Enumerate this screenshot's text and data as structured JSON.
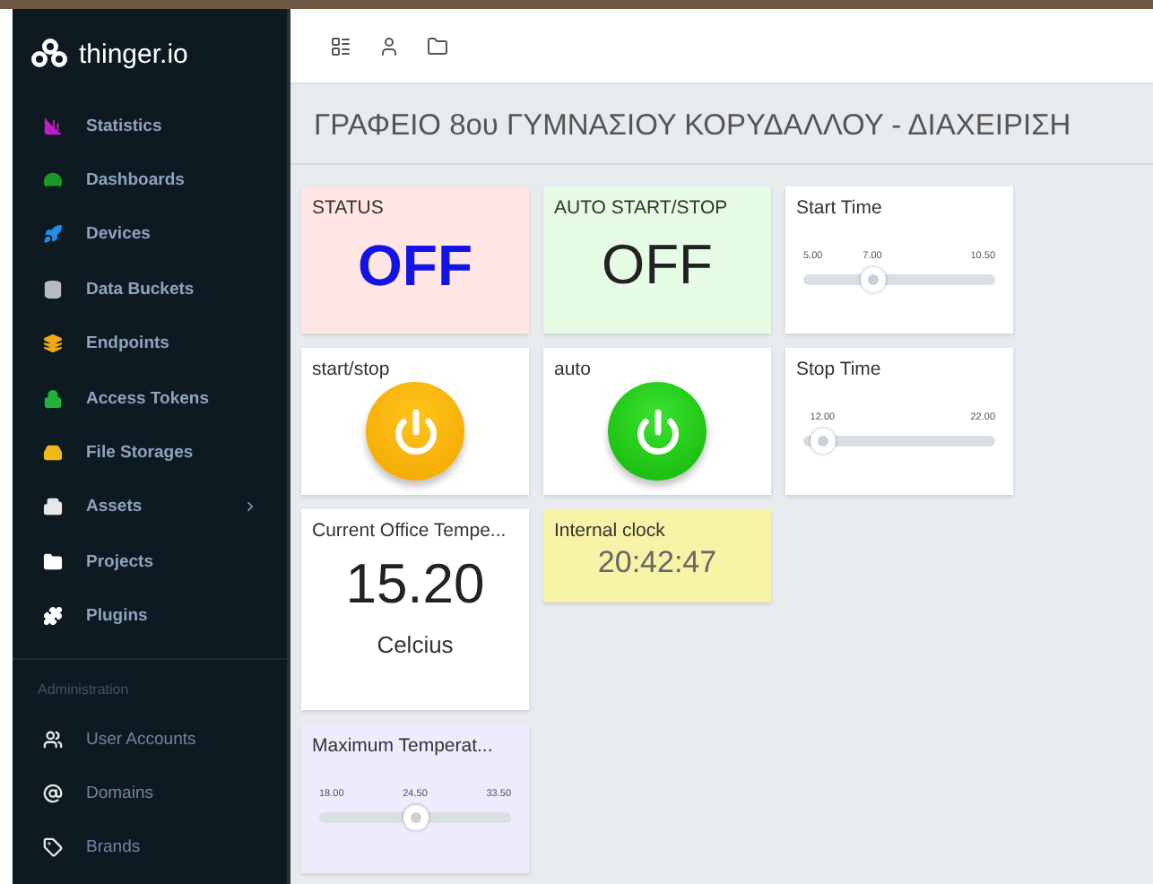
{
  "sidebar": {
    "brand": "thinger.io",
    "items": [
      {
        "label": "Statistics",
        "color": "#c01ec8",
        "arrow": false
      },
      {
        "label": "Dashboards",
        "color": "#1a9a2a",
        "arrow": false
      },
      {
        "label": "Devices",
        "color": "#1e8fe8",
        "arrow": false
      },
      {
        "label": "Data Buckets",
        "color": "#b8bcc0",
        "arrow": false
      },
      {
        "label": "Endpoints",
        "color": "#f0a818",
        "arrow": false
      },
      {
        "label": "Access Tokens",
        "color": "#22b43a",
        "arrow": false
      },
      {
        "label": "File Storages",
        "color": "#f0b818",
        "arrow": false
      },
      {
        "label": "Assets",
        "color": "#e8e8e8",
        "arrow": true
      },
      {
        "label": "Projects",
        "color": "#ffffff",
        "arrow": false
      },
      {
        "label": "Plugins",
        "color": "#ffffff",
        "arrow": false
      }
    ],
    "section": "Administration",
    "admin_items": [
      {
        "label": "User Accounts"
      },
      {
        "label": "Domains"
      },
      {
        "label": "Brands"
      }
    ]
  },
  "title": "ΓΡΑΦΕΙΟ 8ου ΓΥΜΝΑΣΙΟΥ ΚΟΡΥΔΑΛΛΟΥ - ΔΙΑΧΕΙΡΙΣΗ",
  "rows": [
    [
      {
        "kind": "value",
        "title": "STATUS",
        "value": "OFF",
        "emphasis": true,
        "color": "#ffe6e4"
      },
      {
        "kind": "value",
        "title": "AUTO START/STOP",
        "value": "OFF",
        "emphasis": false,
        "color": "#e6fbe4"
      },
      {
        "kind": "slider",
        "title": "Start Time",
        "labels": [
          {
            "kind": "min",
            "text": "5.00"
          },
          {
            "kind": "value",
            "text": "7.00"
          },
          {
            "kind": "max",
            "text": "10.50"
          }
        ],
        "level": 0.36,
        "color": "#ffffff"
      }
    ],
    [
      {
        "kind": "power",
        "title": "start/stop",
        "on": false,
        "color": "#ffffff"
      },
      {
        "kind": "power",
        "title": "auto",
        "on": true,
        "color": "#ffffff"
      },
      {
        "kind": "slider",
        "title": "Stop Time",
        "labels": [
          {
            "kind": "value",
            "text": "12.00"
          },
          {
            "kind": "max",
            "text": "22.00"
          }
        ],
        "level": 0.1,
        "color": "#ffffff"
      }
    ],
    [
      {
        "kind": "value",
        "title": "Current Office Tempe...",
        "value": "15.20",
        "unit": "Celcius",
        "emphasis": false,
        "color": "#ffffff"
      },
      {
        "kind": "clock",
        "title": "Internal clock",
        "value": "20:42:47",
        "color": "#f6f3a6"
      }
    ],
    [
      {
        "kind": "slider",
        "title": "Maximum Temperat...",
        "labels": [
          {
            "kind": "min",
            "text": "18.00"
          },
          {
            "kind": "value",
            "text": "24.50"
          },
          {
            "kind": "max",
            "text": "33.50"
          }
        ],
        "level": 0.5,
        "color": "#eeebfd"
      }
    ]
  ]
}
